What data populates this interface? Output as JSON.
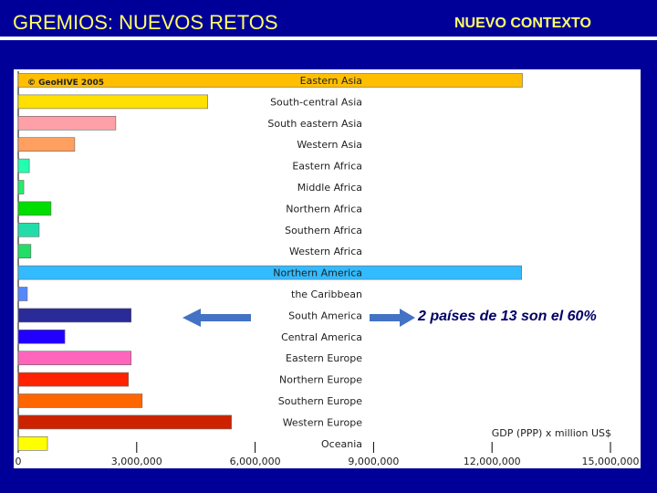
{
  "header": {
    "title": "GREMIOS: NUEVOS RETOS",
    "subtitle": "NUEVO CONTEXTO"
  },
  "annotation": "2 países de 13 son el 60%",
  "chart_data": {
    "type": "bar",
    "orientation": "horizontal",
    "credit": "© GeoHIVE 2005",
    "xlabel": "GDP (PPP) x million US$",
    "xlim": [
      0,
      15000000
    ],
    "xticks": [
      "0",
      "3,000,000",
      "6,000,000",
      "9,000,000",
      "12,000,000",
      "15,000,000"
    ],
    "categories": [
      "Eastern Asia",
      "South-central Asia",
      "South eastern Asia",
      "Western Asia",
      "Eastern Africa",
      "Middle Africa",
      "Northern Africa",
      "Southern Africa",
      "Western Africa",
      "Northern America",
      "the Caribbean",
      "South America",
      "Central America",
      "Eastern Europe",
      "Northern Europe",
      "Southern Europe",
      "Western Europe",
      "Oceania"
    ],
    "values": [
      12770000,
      4800000,
      2470000,
      1430000,
      280000,
      140000,
      830000,
      530000,
      320000,
      12750000,
      230000,
      2860000,
      1180000,
      2860000,
      2790000,
      3140000,
      5400000,
      740000
    ],
    "colors": [
      "#ffbf00",
      "#ffe000",
      "#ffa0a8",
      "#ffa060",
      "#22ffb0",
      "#22ee66",
      "#00dd00",
      "#22ddaa",
      "#22dd66",
      "#33bbff",
      "#5588ff",
      "#2a2a99",
      "#2200ff",
      "#ff66bb",
      "#ff2200",
      "#ff6600",
      "#cc2200",
      "#ffff00"
    ]
  }
}
